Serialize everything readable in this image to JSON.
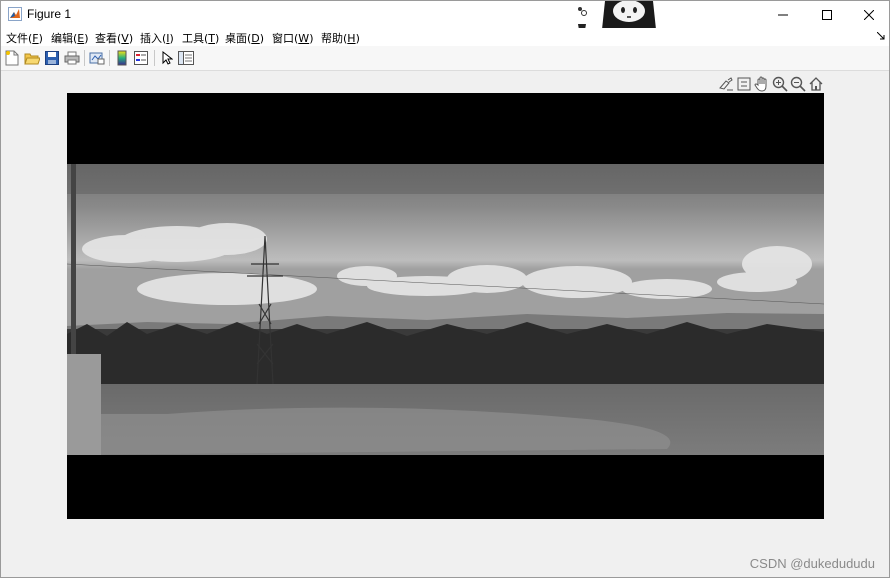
{
  "window": {
    "title": "Figure 1"
  },
  "menu": {
    "items": [
      {
        "label": "文件(",
        "acc": "F",
        "end": ")"
      },
      {
        "label": "编辑(",
        "acc": "E",
        "end": ")"
      },
      {
        "label": "查看(",
        "acc": "V",
        "end": ")"
      },
      {
        "label": "插入(",
        "acc": "I",
        "end": ")"
      },
      {
        "label": "工具(",
        "acc": "T",
        "end": ")"
      },
      {
        "label": "桌面(",
        "acc": "D",
        "end": ")"
      },
      {
        "label": "窗口(",
        "acc": "W",
        "end": ")"
      },
      {
        "label": "帮助(",
        "acc": "H",
        "end": ")"
      }
    ]
  },
  "toolbar": {
    "icons": [
      "new-figure-icon",
      "open-file-icon",
      "save-icon",
      "print-icon",
      "link-plot-icon",
      "insert-colorbar-icon",
      "insert-legend-icon",
      "edit-plot-pointer-icon",
      "property-inspector-icon"
    ]
  },
  "axes_toolbar": {
    "icons": [
      "brush-icon",
      "data-tips-icon",
      "pan-icon",
      "zoom-in-icon",
      "zoom-out-icon",
      "restore-view-icon"
    ]
  },
  "figure": {
    "content": "grayscale landscape photo with power tower, trees and clouds"
  },
  "watermark": "CSDN @dukedududu"
}
